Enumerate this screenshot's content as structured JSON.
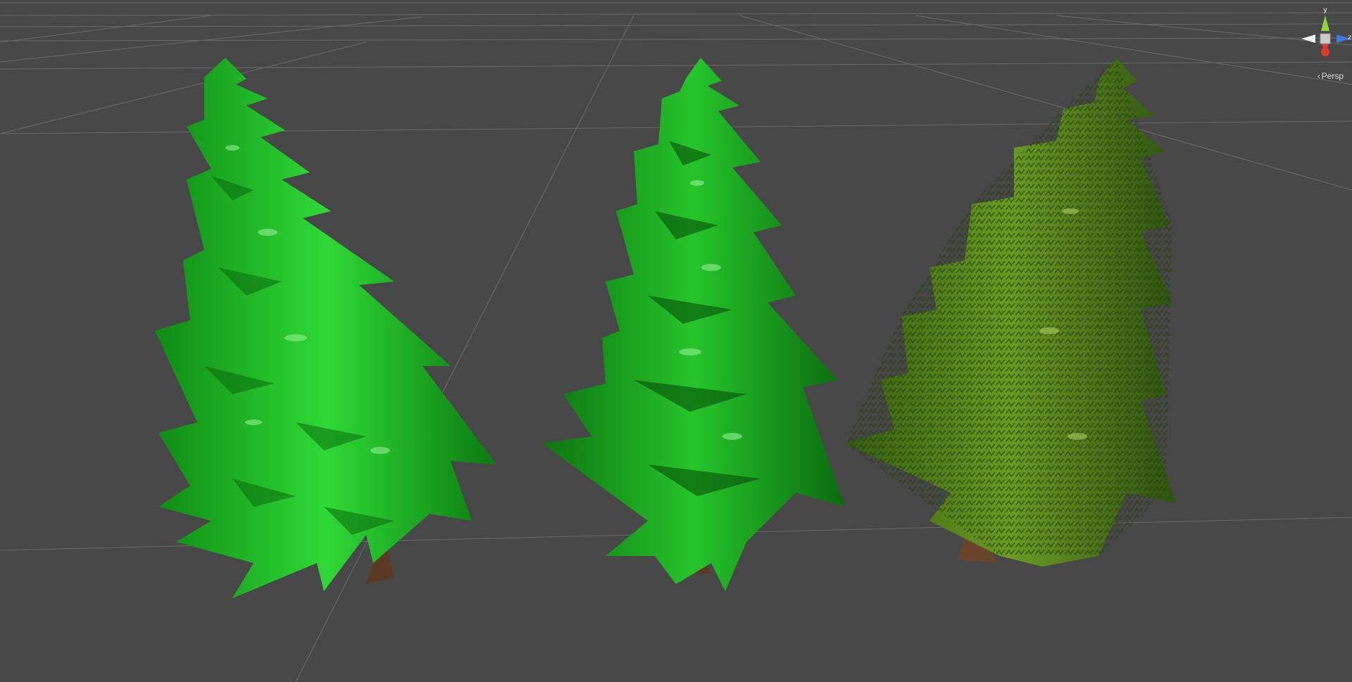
{
  "scene_view": {
    "background_color": "#474747",
    "grid_color": "#6b6b6b",
    "objects": [
      {
        "name": "tree-left",
        "style": "glossy-bright-green",
        "color": "#19b81f"
      },
      {
        "name": "tree-middle",
        "style": "glossy-green-dark-edges",
        "color": "#17a01b"
      },
      {
        "name": "tree-right",
        "style": "textured-olive-needles",
        "color": "#4f7a19"
      }
    ]
  },
  "gizmo": {
    "y_label": "y",
    "z_label": "z",
    "projection_label": "Persp",
    "chevron_icon": "chevron-left-icon",
    "axis_colors": {
      "y": "#8fd43a",
      "z": "#3f79e6",
      "x": "#e23a2a"
    }
  }
}
